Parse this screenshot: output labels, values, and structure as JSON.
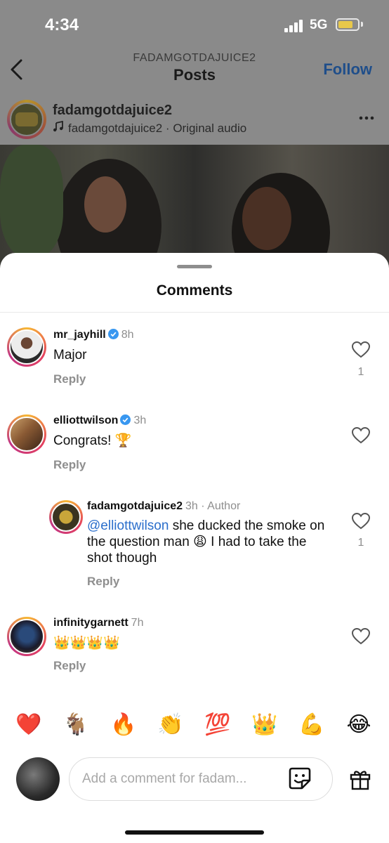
{
  "status_bar": {
    "time": "4:34",
    "network": "5G"
  },
  "nav": {
    "subtitle": "FADAMGOTDAJUICE2",
    "title": "Posts",
    "follow_label": "Follow"
  },
  "post": {
    "username": "fadamgotdajuice2",
    "audio": "fadamgotdajuice2 · Original audio"
  },
  "sheet": {
    "title": "Comments"
  },
  "comments": [
    {
      "username": "mr_jayhill",
      "time": "8h",
      "text": "Major",
      "reply_label": "Reply",
      "likes": "1"
    },
    {
      "username": "elliottwilson",
      "time": "3h",
      "text": "Congrats! 🏆",
      "reply_label": "Reply"
    },
    {
      "username": "fadamgotdajuice2",
      "time": "3h · Author",
      "mention": "@elliottwilson",
      "text": " she ducked the smoke on the question man 😩 I had to take the shot though",
      "reply_label": "Reply",
      "likes": "1"
    },
    {
      "username": "infinitygarnett",
      "time": "7h",
      "text": "👑👑👑👑",
      "reply_label": "Reply"
    }
  ],
  "emoji_bar": [
    "❤️",
    "🐐",
    "🔥",
    "👏",
    "💯",
    "👑",
    "💪",
    "😂"
  ],
  "composer": {
    "placeholder": "Add a comment for fadam..."
  },
  "colors": {
    "accent_blue": "#2a6ecb",
    "verified_blue": "#3897f0",
    "muted": "#8e8e8e"
  }
}
